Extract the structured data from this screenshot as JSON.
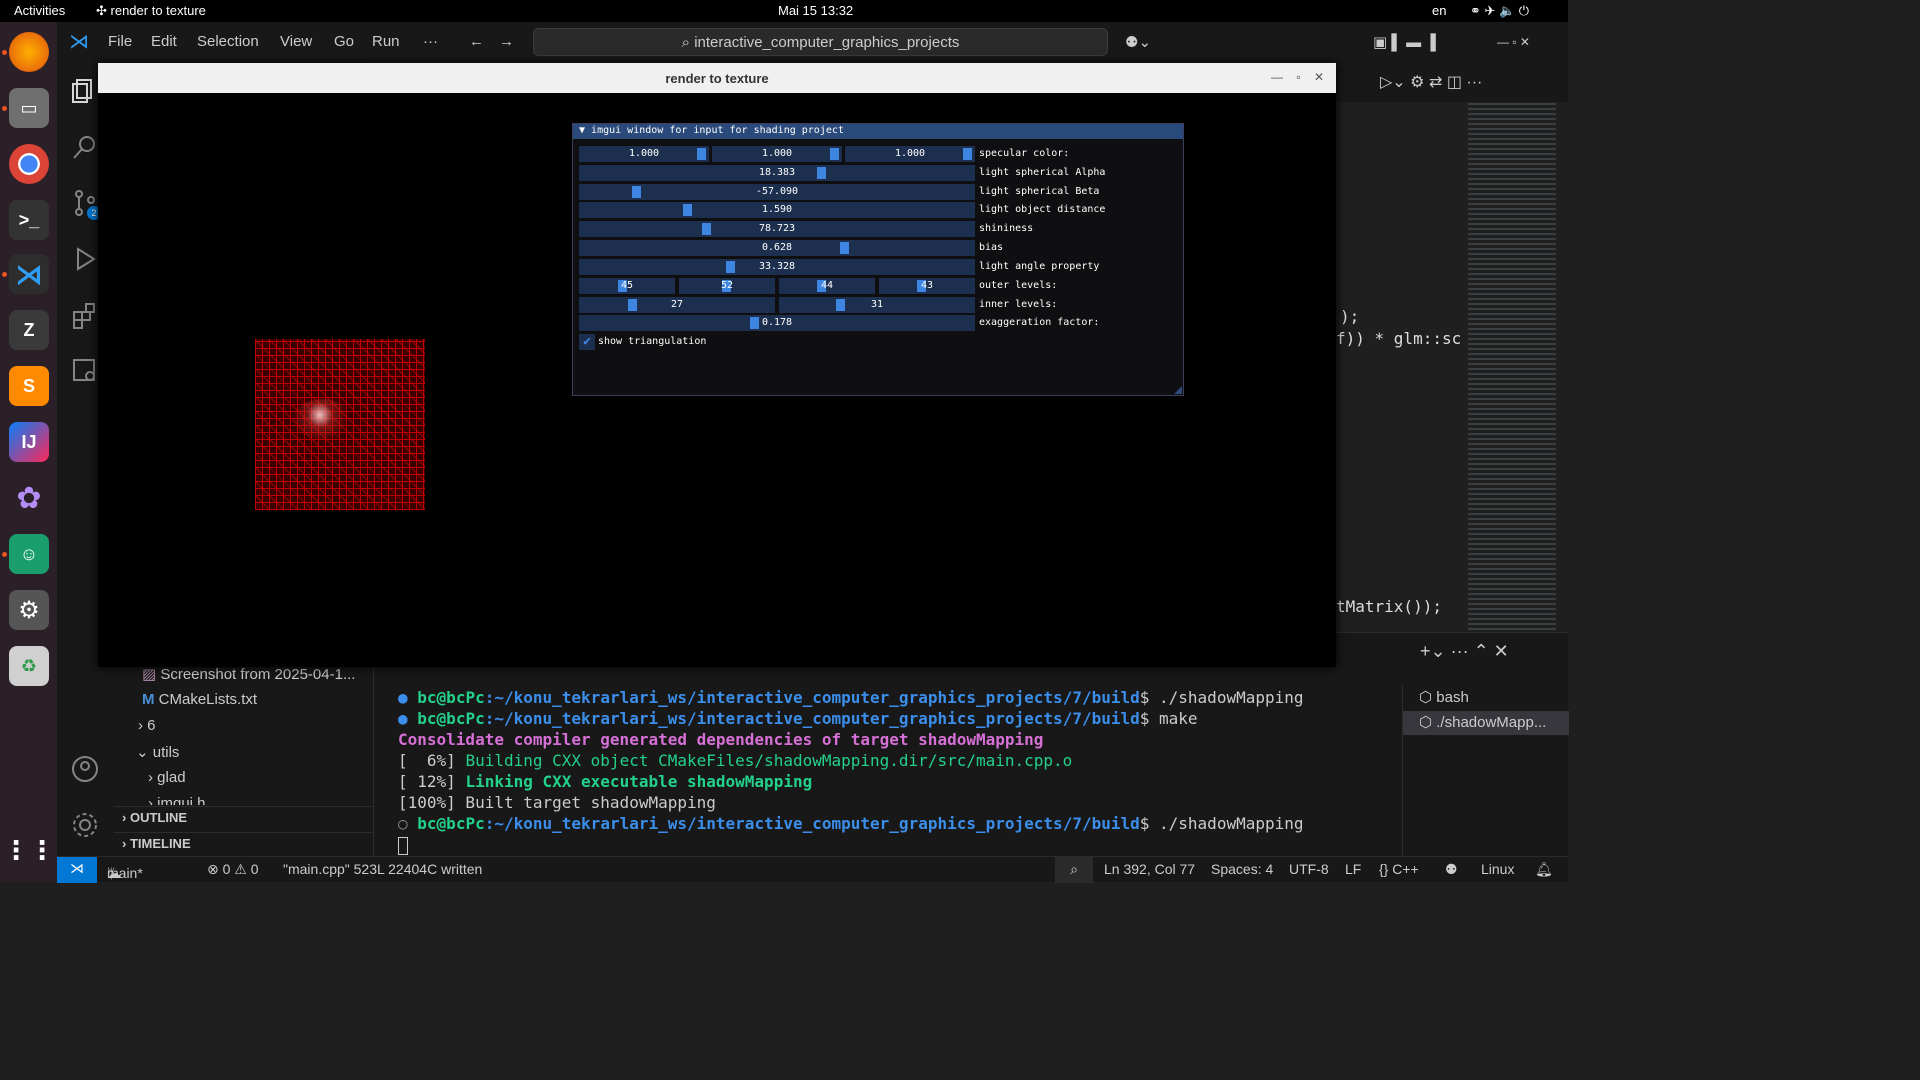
{
  "topbar": {
    "activities": "Activities",
    "app_name": "render to texture",
    "clock": "Mai 15  13:32",
    "lang": "en"
  },
  "vscode": {
    "menu": [
      "File",
      "Edit",
      "Selection",
      "View",
      "Go",
      "Run",
      "···"
    ],
    "search_text": "interactive_computer_graphics_projects"
  },
  "explorer": {
    "items": [
      {
        "label": "Screenshot from 2025-04-1..."
      },
      {
        "label": "CMakeLists.txt"
      },
      {
        "label": "6"
      },
      {
        "label": "utils"
      },
      {
        "label": "glad"
      },
      {
        "label": "imgui.h"
      }
    ],
    "outline": "OUTLINE",
    "timeline": "TIMELINE"
  },
  "editor_code": {
    "line1": ");",
    "line2": "f)) * glm::sc",
    "line3": "tMatrix());"
  },
  "glwindow": {
    "title": "render to texture"
  },
  "imgui": {
    "title": "imgui window for input for shading project",
    "specular": [
      "1.000",
      "1.000",
      "1.000"
    ],
    "rows": [
      {
        "label": "specular color:"
      },
      {
        "label": "light spherical Alpha",
        "value": "18.383"
      },
      {
        "label": "light spherical Beta",
        "value": "-57.090"
      },
      {
        "label": "light object distance",
        "value": "1.590"
      },
      {
        "label": "shininess",
        "value": "78.723"
      },
      {
        "label": "bias",
        "value": "0.628"
      },
      {
        "label": "light angle property",
        "value": "33.328"
      },
      {
        "label": "outer levels:",
        "values": [
          "45",
          "52",
          "44",
          "43"
        ]
      },
      {
        "label": "inner levels:",
        "values": [
          "27",
          "31"
        ]
      },
      {
        "label": "exaggeration factor:",
        "value": "0.178"
      }
    ],
    "checkbox_label": "show triangulation",
    "checkbox_checked": true
  },
  "terminal": {
    "prompt_user": "bc@bcPc",
    "prompt_path": ":~/konu_tekrarlari_ws/interactive_computer_graphics_projects/7/build",
    "cmd1": "$ ./shadowMapping",
    "cmd2": "$ make",
    "out1": "Consolidate compiler generated dependencies of target shadowMapping",
    "out2_prefix": "[  6%] ",
    "out2": "Building CXX object CMakeFiles/shadowMapping.dir/src/main.cpp.o",
    "out3_prefix": "[ 12%] ",
    "out3": "Linking CXX executable shadowMapping",
    "out4": "[100%] Built target shadowMapping",
    "cmd3": "$ ./shadowMapping",
    "tabs": [
      "bash",
      "./shadowMapp..."
    ]
  },
  "statusbar": {
    "branch": "main*",
    "problems": "⊗ 0 ⚠ 0",
    "message": "\"main.cpp\" 523L 22404C written",
    "position": "Ln 392, Col 77",
    "spaces": "Spaces: 4",
    "encoding": "UTF-8",
    "eol": "LF",
    "language": "{} C++",
    "os": "Linux"
  },
  "colors": {
    "accent": "#0078d4",
    "prompt_green": "#23d18b",
    "path_blue": "#3b8eea",
    "magenta": "#d670d6",
    "mesh_red": "#c00000"
  }
}
